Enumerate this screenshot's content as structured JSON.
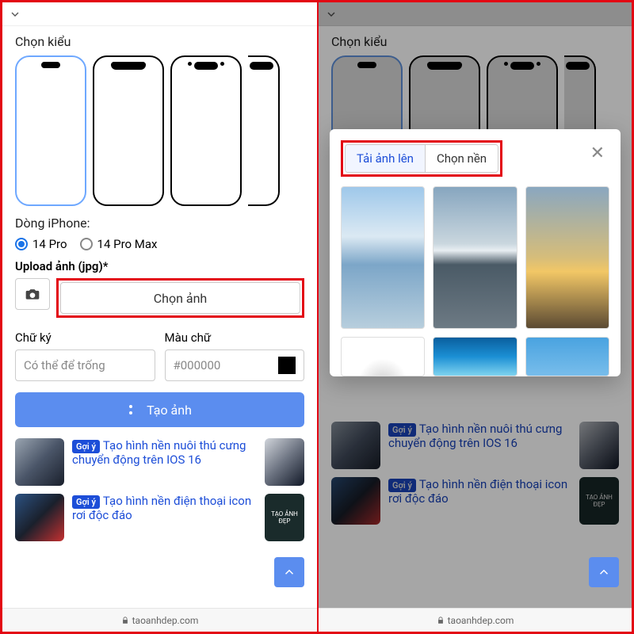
{
  "left": {
    "style_label": "Chọn kiểu",
    "phone_line_label": "Dòng iPhone:",
    "radios": {
      "opt1": "14 Pro",
      "opt2": "14 Pro Max"
    },
    "upload_label": "Upload ảnh (jpg)*",
    "choose_image": "Chọn ảnh",
    "signature_label": "Chữ ký",
    "signature_placeholder": "Có thể để trống",
    "color_label": "Màu chữ",
    "color_value": "#000000",
    "create_btn": "Tạo ảnh",
    "badge": "Gợi ý",
    "sug1": "Tạo hình nền nuôi thú cưng chuyển động trên IOS 16",
    "sug2": "Tạo hình nền điện thoại icon rơi độc đáo",
    "thumb_r2_text": "TẠO ẢNH ĐẸP"
  },
  "modal": {
    "tab_upload": "Tải ảnh lên",
    "tab_bg": "Chọn nền"
  },
  "footer_domain": "taoanhdep.com"
}
